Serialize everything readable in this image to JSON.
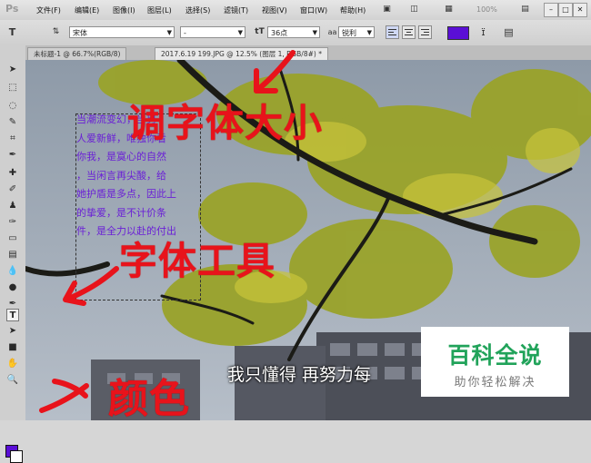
{
  "app": {
    "logo": "Ps"
  },
  "menu": {
    "items": [
      "文件(F)",
      "编辑(E)",
      "图像(I)",
      "图层(L)",
      "选择(S)",
      "滤镜(T)",
      "视图(V)",
      "窗口(W)",
      "帮助(H)"
    ],
    "right_label": "100%"
  },
  "options": {
    "font_family": "宋体",
    "font_style": "-",
    "font_size": "36点",
    "antialias": "锐利",
    "text_color": "#5a0fd6"
  },
  "tabs": [
    {
      "label": "未标题-1 @ 66.7%(RGB/8)",
      "active": false
    },
    {
      "label": "2017.6.19 199.JPG @ 12.5% (图层 1, RGB/8#) *",
      "active": true
    }
  ],
  "canvas": {
    "paragraph_lines": [
      "当潮流变幻，当另",
      "人爱新鲜，唯独你看",
      "你我，是寞心的自然",
      "，当闲言再尖酸，给",
      "她护盾是多点，因此上",
      "的挚爱，是不计价条",
      "件，是全力以赴的付出"
    ],
    "annotations": {
      "resize_text": "调字体大小",
      "type_tool": "字体工具",
      "color": "颜色"
    },
    "subtitle": "我只懂得 再努力每"
  },
  "watermark": {
    "title": "百科全说",
    "subtitle": "助你轻松解决"
  },
  "colors": {
    "accent_text": "#6a1fd6",
    "annotation_red": "#e8131b",
    "watermark_green": "#21a35a"
  }
}
